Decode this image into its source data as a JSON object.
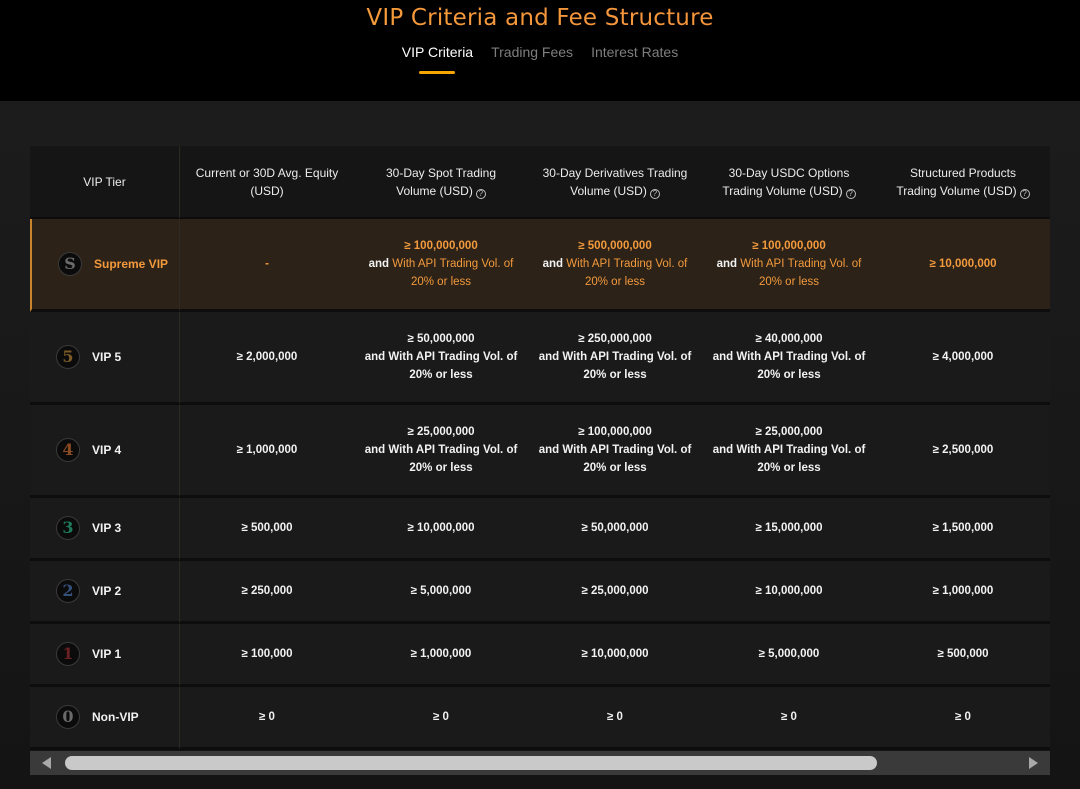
{
  "header": {
    "title": "VIP Criteria and Fee Structure",
    "tabs": [
      {
        "label": "VIP Criteria",
        "active": true
      },
      {
        "label": "Trading Fees",
        "active": false
      },
      {
        "label": "Interest Rates",
        "active": false
      }
    ]
  },
  "table": {
    "columns": [
      {
        "line1": "VIP Tier",
        "line2": "",
        "help": false
      },
      {
        "line1": "Current or 30D Avg. Equity",
        "line2": "(USD)",
        "help": false
      },
      {
        "line1": "30-Day Spot Trading",
        "line2": "Volume (USD)",
        "help": true
      },
      {
        "line1": "30-Day Derivatives Trading",
        "line2": "Volume (USD)",
        "help": true
      },
      {
        "line1": "30-Day USDC Options",
        "line2": "Trading Volume (USD)",
        "help": true
      },
      {
        "line1": "Structured Products",
        "line2": "Trading Volume (USD)",
        "help": true
      }
    ],
    "api_suffix": {
      "and": "and",
      "with_api": "With API",
      "trading_vol": "Trading Vol. of",
      "pct": "20%",
      "or_less": "or less"
    },
    "rows": [
      {
        "badge": "S",
        "badge_color": "#6a6a6a",
        "tier": "Supreme VIP",
        "equity": "-",
        "spot": "≥ 100,000,000",
        "derivatives": "≥ 500,000,000",
        "options": "≥ 100,000,000",
        "structured": "≥ 10,000,000"
      },
      {
        "badge": "5",
        "badge_color": "#7a5a26",
        "tier": "VIP 5",
        "equity": "≥ 2,000,000",
        "spot": "≥ 50,000,000",
        "derivatives": "≥ 250,000,000",
        "options": "≥ 40,000,000",
        "structured": "≥ 4,000,000"
      },
      {
        "badge": "4",
        "badge_color": "#8a4a22",
        "tier": "VIP 4",
        "equity": "≥ 1,000,000",
        "spot": "≥ 25,000,000",
        "derivatives": "≥ 100,000,000",
        "options": "≥ 25,000,000",
        "structured": "≥ 2,500,000"
      },
      {
        "badge": "3",
        "badge_color": "#1f7a5a",
        "tier": "VIP 3",
        "equity": "≥ 500,000",
        "spot": "≥ 10,000,000",
        "derivatives": "≥ 50,000,000",
        "options": "≥ 15,000,000",
        "structured": "≥ 1,500,000"
      },
      {
        "badge": "2",
        "badge_color": "#34507a",
        "tier": "VIP 2",
        "equity": "≥ 250,000",
        "spot": "≥ 5,000,000",
        "derivatives": "≥ 25,000,000",
        "options": "≥ 10,000,000",
        "structured": "≥ 1,000,000"
      },
      {
        "badge": "1",
        "badge_color": "#6a1f22",
        "tier": "VIP 1",
        "equity": "≥ 100,000",
        "spot": "≥ 1,000,000",
        "derivatives": "≥ 10,000,000",
        "options": "≥ 5,000,000",
        "structured": "≥ 500,000"
      },
      {
        "badge": "0",
        "badge_color": "#6a6a6a",
        "tier": "Non-VIP",
        "equity": "≥ 0",
        "spot": "≥ 0",
        "derivatives": "≥ 0",
        "options": "≥ 0",
        "structured": "≥ 0"
      }
    ]
  },
  "colors": {
    "accent": "#f7a600",
    "supreme_text": "#f39a3d",
    "supreme_row_bg": "#2c2217"
  }
}
